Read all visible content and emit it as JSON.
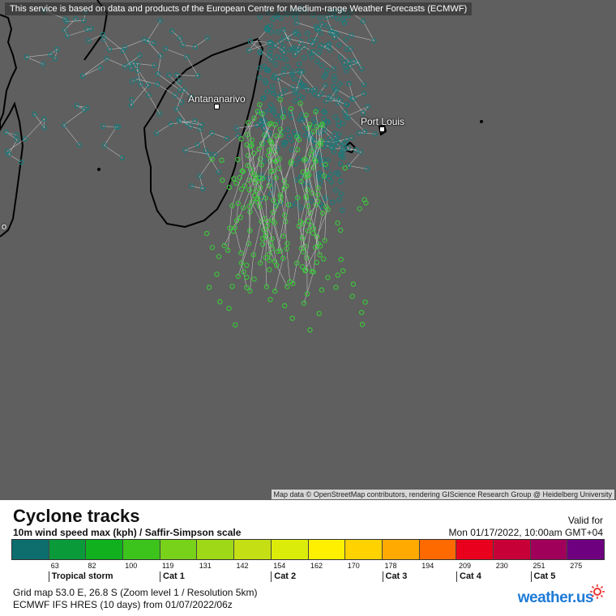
{
  "map": {
    "top_note": "This service is based on data and products of the European Centre for Medium-range Weather Forecasts (ECMWF)",
    "attribution": "Map data © OpenStreetMap contributors, rendering GIScience Research Group @ Heidelberg University",
    "cities": [
      {
        "name": "Antananarivo"
      },
      {
        "name": "Port Louis"
      }
    ],
    "edge_label": "o",
    "colors": {
      "sea": "#5f5f5f",
      "coast": "#000000",
      "track_north": "#1c7a7a",
      "track_south": "#3cc43c"
    }
  },
  "legend": {
    "title": "Cyclone tracks",
    "subtitle": "10m wind speed max (kph) / Saffir-Simpson scale",
    "valid_label": "Valid for",
    "valid_date": "Mon 01/17/2022, 10:00am GMT+04",
    "colors": [
      "#0e6e6e",
      "#0a9a3a",
      "#10b01e",
      "#3cc41c",
      "#78d21a",
      "#9ed817",
      "#c4e014",
      "#dcec0a",
      "#fff000",
      "#ffd200",
      "#ffaa00",
      "#ff6a00",
      "#e8001c",
      "#c80038",
      "#a0005a",
      "#6e0080"
    ],
    "ticks": [
      "63",
      "82",
      "100",
      "119",
      "131",
      "142",
      "154",
      "162",
      "170",
      "178",
      "194",
      "209",
      "230",
      "251",
      "275"
    ],
    "categories": [
      {
        "label": "Tropical storm",
        "index": 1
      },
      {
        "label": "Cat 1",
        "index": 4
      },
      {
        "label": "Cat 2",
        "index": 7
      },
      {
        "label": "Cat 3",
        "index": 10
      },
      {
        "label": "Cat 4",
        "index": 12
      },
      {
        "label": "Cat 5",
        "index": 14
      }
    ],
    "grid_info": "Grid map 53.0 E, 26.8 S (Zoom level 1 / Resolution 5km)",
    "model_info": "ECMWF IFS HRES (10 days) from  01/07/2022/06z",
    "brand": "weather.us"
  }
}
